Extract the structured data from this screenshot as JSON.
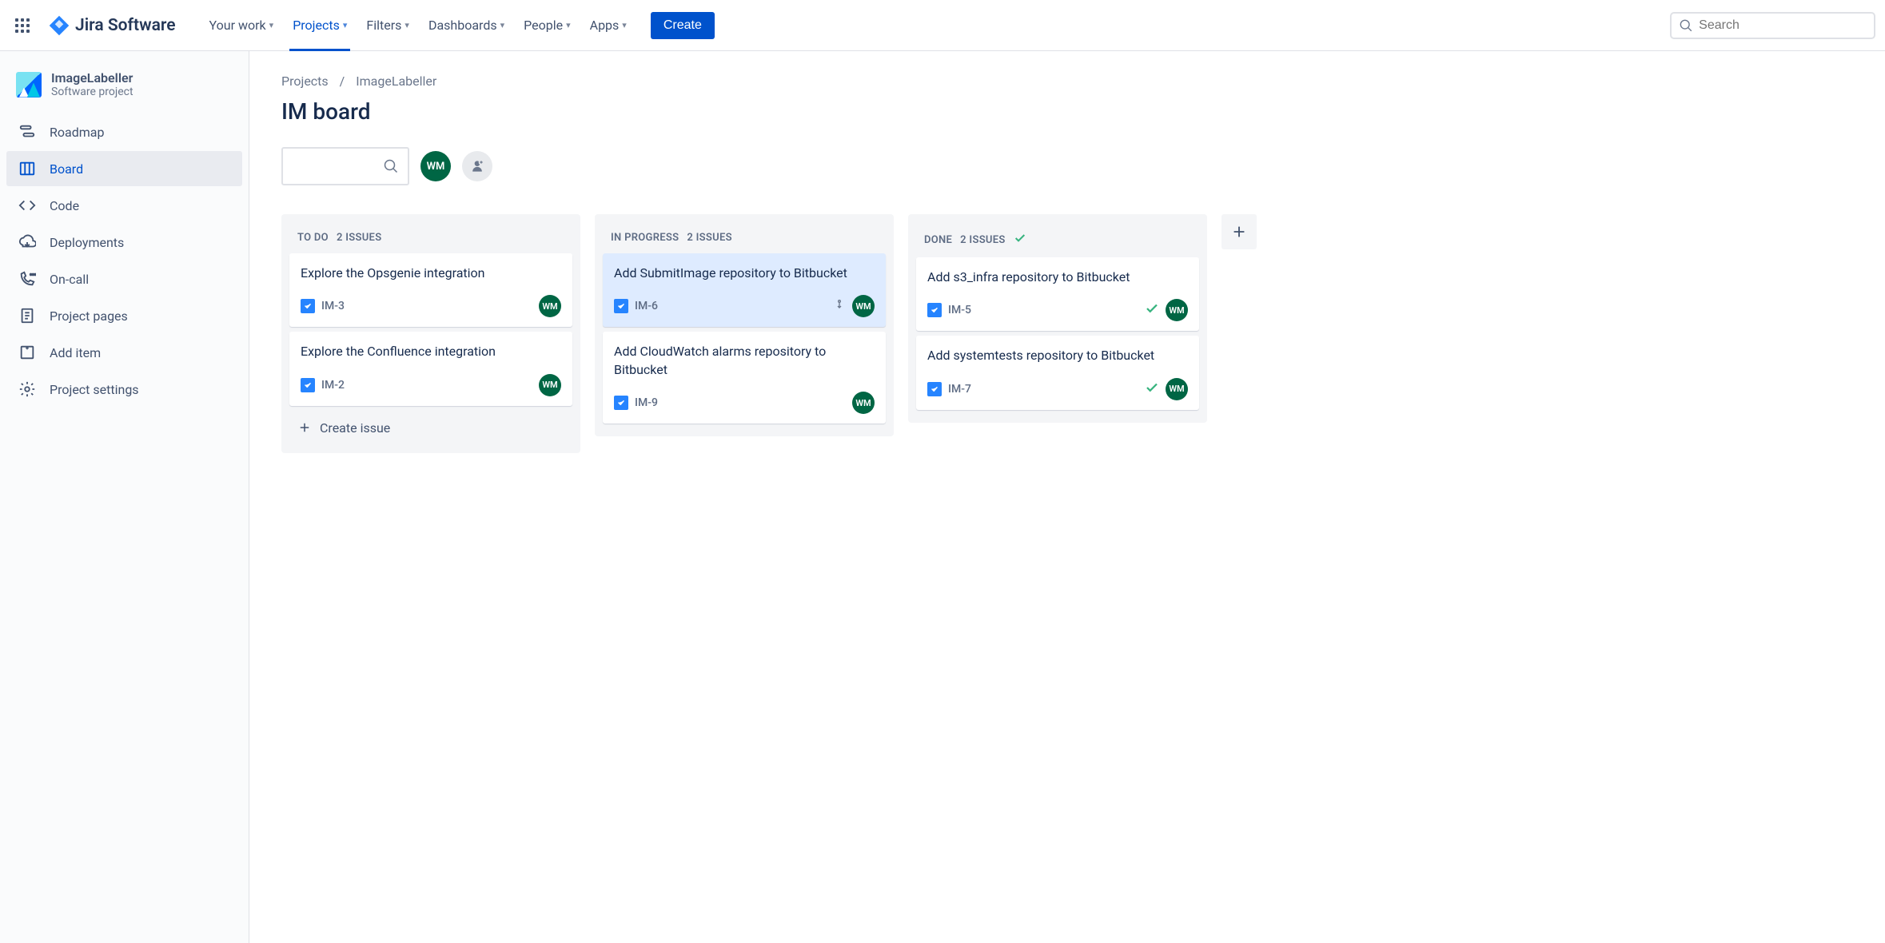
{
  "topnav": {
    "logo_text": "Jira Software",
    "items": [
      "Your work",
      "Projects",
      "Filters",
      "Dashboards",
      "People",
      "Apps"
    ],
    "active_index": 1,
    "create_label": "Create",
    "search_placeholder": "Search"
  },
  "project": {
    "name": "ImageLabeller",
    "type": "Software project"
  },
  "sidebar": {
    "items": [
      "Roadmap",
      "Board",
      "Code",
      "Deployments",
      "On-call",
      "Project pages",
      "Add item",
      "Project settings"
    ],
    "active_index": 1
  },
  "breadcrumb": [
    "Projects",
    "ImageLabeller"
  ],
  "page_title": "IM board",
  "user_initials": "WM",
  "columns": [
    {
      "name": "TO DO",
      "count_label": "2 ISSUES",
      "done": false,
      "cards": [
        {
          "title": "Explore the Opsgenie integration",
          "key": "IM-3",
          "assignee": "WM",
          "highlight": false,
          "done": false,
          "priority": false
        },
        {
          "title": "Explore the Confluence integration",
          "key": "IM-2",
          "assignee": "WM",
          "highlight": false,
          "done": false,
          "priority": false
        }
      ],
      "create_label": "Create issue"
    },
    {
      "name": "IN PROGRESS",
      "count_label": "2 ISSUES",
      "done": false,
      "cards": [
        {
          "title": "Add SubmitImage repository to Bitbucket",
          "key": "IM-6",
          "assignee": "WM",
          "highlight": true,
          "done": false,
          "priority": true
        },
        {
          "title": "Add CloudWatch alarms repository to Bitbucket",
          "key": "IM-9",
          "assignee": "WM",
          "highlight": false,
          "done": false,
          "priority": false
        }
      ]
    },
    {
      "name": "DONE",
      "count_label": "2 ISSUES",
      "done": true,
      "cards": [
        {
          "title": "Add s3_infra repository to Bitbucket",
          "key": "IM-5",
          "assignee": "WM",
          "highlight": false,
          "done": true,
          "priority": false
        },
        {
          "title": "Add systemtests repository to Bitbucket",
          "key": "IM-7",
          "assignee": "WM",
          "highlight": false,
          "done": true,
          "priority": false
        }
      ]
    }
  ]
}
